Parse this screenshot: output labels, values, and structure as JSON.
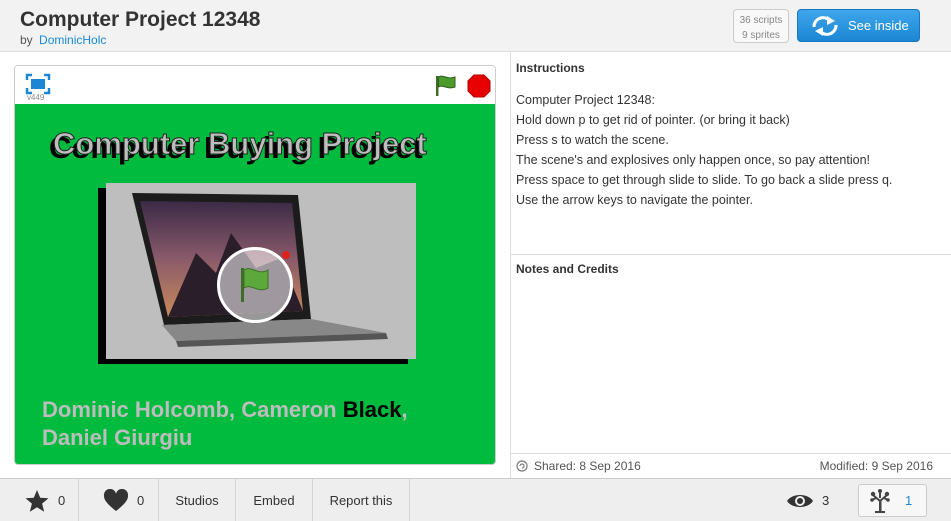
{
  "header": {
    "title": "Computer Project 12348",
    "by_label": "by",
    "author": "DominicHolc",
    "scripts_count": "36 scripts",
    "sprites_count": "9 sprites",
    "see_inside_label": "See inside"
  },
  "player": {
    "version": "v449",
    "stage_title": "Computer Buying Project",
    "credits_part1": "Dominic Holcomb, Cameron ",
    "credits_black": "Black",
    "credits_part2": ",",
    "credits_line2": "Daniel Giurgiu",
    "stage_color": "#00bb3e"
  },
  "instructions": {
    "heading": "Instructions",
    "lines": [
      "Computer Project 12348:",
      "Hold down p to get rid of pointer. (or bring it back)",
      "Press s to watch the scene.",
      "The scene's and explosives only happen once, so pay attention!",
      "Press space to get through slide to slide. To go back a slide press q.",
      "Use the arrow keys to navigate the pointer."
    ]
  },
  "notes": {
    "heading": "Notes and Credits"
  },
  "meta": {
    "shared": "Shared: 8 Sep 2016",
    "modified": "Modified: 9 Sep 2016"
  },
  "footer": {
    "favorites": "0",
    "loves": "0",
    "studios_label": "Studios",
    "embed_label": "Embed",
    "report_label": "Report this",
    "views": "3",
    "remixes": "1"
  },
  "colors": {
    "accent": "#1c86d4",
    "link": "#1a8ad6"
  },
  "icons": {
    "fullscreen": "fullscreen-icon",
    "green_flag": "green-flag-icon",
    "stop": "stop-sign-icon",
    "star": "star-icon",
    "heart": "heart-icon",
    "eye": "eye-icon",
    "remix_tree": "remix-tree-icon",
    "see_inside": "see-inside-arrows-icon"
  }
}
